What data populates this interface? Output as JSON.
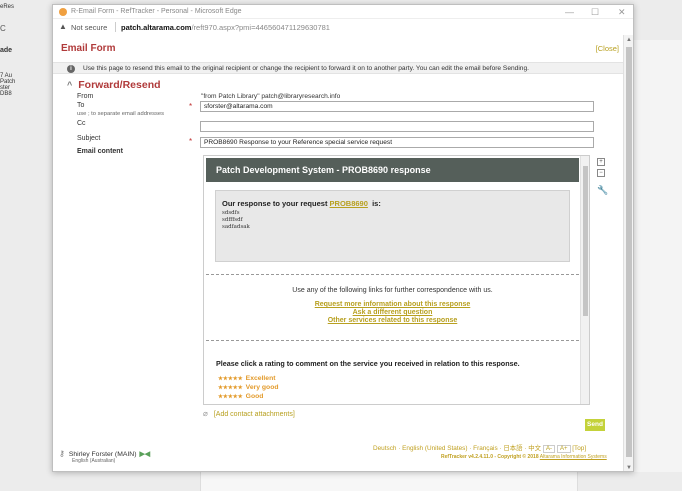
{
  "background": {
    "text_lines": [
      "eRes",
      "ade",
      "7 Au",
      "Patch",
      "ster",
      "DB8"
    ],
    "address_c": "C"
  },
  "window": {
    "title": "R-Email Form - RefTracker - Personal - Microsoft Edge",
    "minimize": "—",
    "maximize": "☐",
    "close": "✕"
  },
  "address_bar": {
    "not_secure": "Not secure",
    "host": "patch.altarama.com",
    "path": "/reft970.aspx?pmi=446560471129630781"
  },
  "form": {
    "title": "Email Form",
    "close_link": "[Close]",
    "info": "Use this page to resend this email to the original recipient or change the recipient to forward it on to another party. You can edit the email before Sending.",
    "section_title": "Forward/Resend",
    "from_label": "From",
    "from_value": "\"from Patch Library\" patch@libraryresearch.info",
    "to_label": "To",
    "to_hint": "use ; to separate email addresses",
    "to_value": "sforster@altarama.com",
    "cc_label": "Cc",
    "cc_value": "",
    "subject_label": "Subject",
    "subject_value": "PROB8690 Response to your Reference special service  request",
    "content_label": "Email content",
    "required_mark": "*"
  },
  "email": {
    "header": "Patch Development System - PROB8690 response",
    "response_prefix": "Our response to your request",
    "response_link": "PROB8690",
    "response_suffix": "is:",
    "body_lines": [
      "sdsdfs",
      "sdfffsdf",
      "sadfadsak"
    ],
    "links_intro": "Use any of the following links for further correspondence with us.",
    "link1": "Request more information about this response",
    "link2": "Ask a different question",
    "link3": "Other services related to this response",
    "rating_heading": "Please click a rating to comment on the service you received in relation to this response.",
    "ratings": [
      {
        "stars": "★★★★★",
        "label": "Excellent"
      },
      {
        "stars": "★★★★★",
        "label": "Very good"
      },
      {
        "stars": "★★★★★",
        "label": "Good"
      }
    ]
  },
  "toolbar": {
    "btn1": "+",
    "btn2": "−",
    "wrench": "🔧"
  },
  "attach": {
    "label": "[Add contact attachments]"
  },
  "send_label": "Send",
  "footer": {
    "languages": "Deutsch · English (United States) · Français · 日本語 · 中文",
    "size_small": "A-",
    "size_large": "A+",
    "top_link": "[Top]",
    "copyright_prefix": "RefTracker v4.2.4.11.0 - Copyright © 2018",
    "copyright_link": "Altarama Information Systems",
    "user_name": "Shirley Forster (MAIN)",
    "user_env": "▶◀",
    "user_locale": "English (Australian)"
  },
  "colors": {
    "accent_red": "#b03a3a",
    "link_gold": "#b8a020",
    "header_gray": "#555f5a",
    "rating_orange": "#e39b2c",
    "send_green": "#c4d23a"
  }
}
